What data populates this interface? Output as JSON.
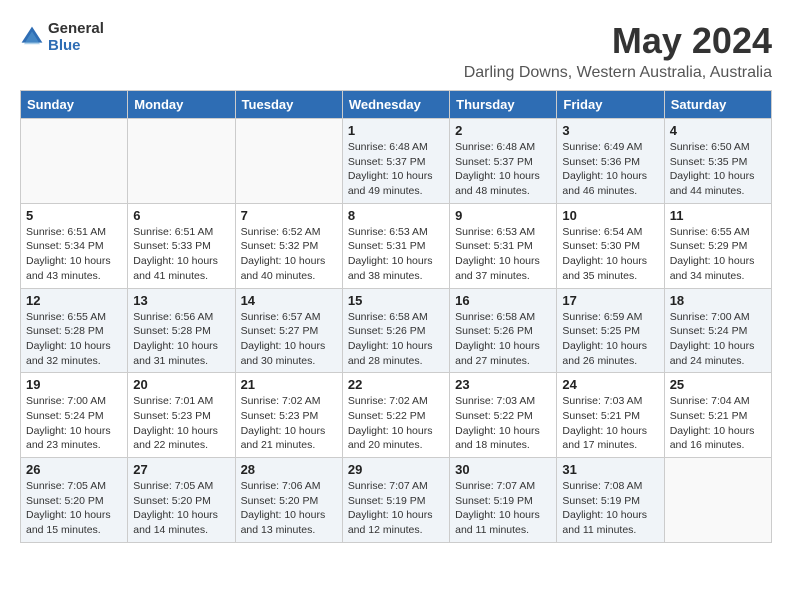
{
  "logo": {
    "line1": "General",
    "line2": "Blue"
  },
  "title": "May 2024",
  "subtitle": "Darling Downs, Western Australia, Australia",
  "days_of_week": [
    "Sunday",
    "Monday",
    "Tuesday",
    "Wednesday",
    "Thursday",
    "Friday",
    "Saturday"
  ],
  "weeks": [
    [
      {
        "day": "",
        "info": ""
      },
      {
        "day": "",
        "info": ""
      },
      {
        "day": "",
        "info": ""
      },
      {
        "day": "1",
        "info": "Sunrise: 6:48 AM\nSunset: 5:37 PM\nDaylight: 10 hours\nand 49 minutes."
      },
      {
        "day": "2",
        "info": "Sunrise: 6:48 AM\nSunset: 5:37 PM\nDaylight: 10 hours\nand 48 minutes."
      },
      {
        "day": "3",
        "info": "Sunrise: 6:49 AM\nSunset: 5:36 PM\nDaylight: 10 hours\nand 46 minutes."
      },
      {
        "day": "4",
        "info": "Sunrise: 6:50 AM\nSunset: 5:35 PM\nDaylight: 10 hours\nand 44 minutes."
      }
    ],
    [
      {
        "day": "5",
        "info": "Sunrise: 6:51 AM\nSunset: 5:34 PM\nDaylight: 10 hours\nand 43 minutes."
      },
      {
        "day": "6",
        "info": "Sunrise: 6:51 AM\nSunset: 5:33 PM\nDaylight: 10 hours\nand 41 minutes."
      },
      {
        "day": "7",
        "info": "Sunrise: 6:52 AM\nSunset: 5:32 PM\nDaylight: 10 hours\nand 40 minutes."
      },
      {
        "day": "8",
        "info": "Sunrise: 6:53 AM\nSunset: 5:31 PM\nDaylight: 10 hours\nand 38 minutes."
      },
      {
        "day": "9",
        "info": "Sunrise: 6:53 AM\nSunset: 5:31 PM\nDaylight: 10 hours\nand 37 minutes."
      },
      {
        "day": "10",
        "info": "Sunrise: 6:54 AM\nSunset: 5:30 PM\nDaylight: 10 hours\nand 35 minutes."
      },
      {
        "day": "11",
        "info": "Sunrise: 6:55 AM\nSunset: 5:29 PM\nDaylight: 10 hours\nand 34 minutes."
      }
    ],
    [
      {
        "day": "12",
        "info": "Sunrise: 6:55 AM\nSunset: 5:28 PM\nDaylight: 10 hours\nand 32 minutes."
      },
      {
        "day": "13",
        "info": "Sunrise: 6:56 AM\nSunset: 5:28 PM\nDaylight: 10 hours\nand 31 minutes."
      },
      {
        "day": "14",
        "info": "Sunrise: 6:57 AM\nSunset: 5:27 PM\nDaylight: 10 hours\nand 30 minutes."
      },
      {
        "day": "15",
        "info": "Sunrise: 6:58 AM\nSunset: 5:26 PM\nDaylight: 10 hours\nand 28 minutes."
      },
      {
        "day": "16",
        "info": "Sunrise: 6:58 AM\nSunset: 5:26 PM\nDaylight: 10 hours\nand 27 minutes."
      },
      {
        "day": "17",
        "info": "Sunrise: 6:59 AM\nSunset: 5:25 PM\nDaylight: 10 hours\nand 26 minutes."
      },
      {
        "day": "18",
        "info": "Sunrise: 7:00 AM\nSunset: 5:24 PM\nDaylight: 10 hours\nand 24 minutes."
      }
    ],
    [
      {
        "day": "19",
        "info": "Sunrise: 7:00 AM\nSunset: 5:24 PM\nDaylight: 10 hours\nand 23 minutes."
      },
      {
        "day": "20",
        "info": "Sunrise: 7:01 AM\nSunset: 5:23 PM\nDaylight: 10 hours\nand 22 minutes."
      },
      {
        "day": "21",
        "info": "Sunrise: 7:02 AM\nSunset: 5:23 PM\nDaylight: 10 hours\nand 21 minutes."
      },
      {
        "day": "22",
        "info": "Sunrise: 7:02 AM\nSunset: 5:22 PM\nDaylight: 10 hours\nand 20 minutes."
      },
      {
        "day": "23",
        "info": "Sunrise: 7:03 AM\nSunset: 5:22 PM\nDaylight: 10 hours\nand 18 minutes."
      },
      {
        "day": "24",
        "info": "Sunrise: 7:03 AM\nSunset: 5:21 PM\nDaylight: 10 hours\nand 17 minutes."
      },
      {
        "day": "25",
        "info": "Sunrise: 7:04 AM\nSunset: 5:21 PM\nDaylight: 10 hours\nand 16 minutes."
      }
    ],
    [
      {
        "day": "26",
        "info": "Sunrise: 7:05 AM\nSunset: 5:20 PM\nDaylight: 10 hours\nand 15 minutes."
      },
      {
        "day": "27",
        "info": "Sunrise: 7:05 AM\nSunset: 5:20 PM\nDaylight: 10 hours\nand 14 minutes."
      },
      {
        "day": "28",
        "info": "Sunrise: 7:06 AM\nSunset: 5:20 PM\nDaylight: 10 hours\nand 13 minutes."
      },
      {
        "day": "29",
        "info": "Sunrise: 7:07 AM\nSunset: 5:19 PM\nDaylight: 10 hours\nand 12 minutes."
      },
      {
        "day": "30",
        "info": "Sunrise: 7:07 AM\nSunset: 5:19 PM\nDaylight: 10 hours\nand 11 minutes."
      },
      {
        "day": "31",
        "info": "Sunrise: 7:08 AM\nSunset: 5:19 PM\nDaylight: 10 hours\nand 11 minutes."
      },
      {
        "day": "",
        "info": ""
      }
    ]
  ]
}
